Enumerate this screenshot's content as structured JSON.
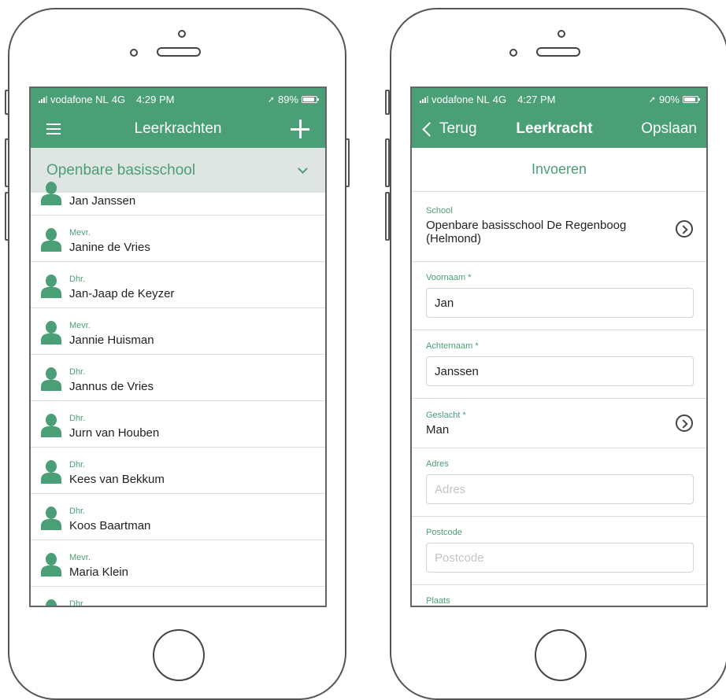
{
  "left_screen": {
    "status": {
      "carrier": "vodafone NL",
      "network": "4G",
      "time": "4:29 PM",
      "battery": "89%"
    },
    "nav": {
      "title": "Leerkrachten",
      "menu_icon": "hamburger-icon",
      "add_icon": "plus-icon"
    },
    "filter": {
      "selected": "Openbare basisschool"
    },
    "teachers": [
      {
        "prefix": "",
        "name": "Jan Janssen"
      },
      {
        "prefix": "Mevr.",
        "name": "Janine de Vries"
      },
      {
        "prefix": "Dhr.",
        "name": "Jan-Jaap de Keyzer"
      },
      {
        "prefix": "Mevr.",
        "name": "Jannie Huisman"
      },
      {
        "prefix": "Dhr.",
        "name": "Jannus de Vries"
      },
      {
        "prefix": "Dhr.",
        "name": "Jurn van Houben"
      },
      {
        "prefix": "Dhr.",
        "name": "Kees van Bekkum"
      },
      {
        "prefix": "Dhr.",
        "name": "Koos Baartman"
      },
      {
        "prefix": "Mevr.",
        "name": "Maria Klein"
      },
      {
        "prefix": "Dhr.",
        "name": ""
      }
    ]
  },
  "right_screen": {
    "status": {
      "carrier": "vodafone NL",
      "network": "4G",
      "time": "4:27 PM",
      "battery": "90%"
    },
    "nav": {
      "back": "Terug",
      "title": "Leerkracht",
      "save": "Opslaan"
    },
    "section_title": "Invoeren",
    "form": {
      "school_label": "School",
      "school_value_line1": "Openbare basisschool De Regenboog",
      "school_value_line2": "(Helmond)",
      "firstname_label": "Voornaam *",
      "firstname_value": "Jan",
      "lastname_label": "Achternaam *",
      "lastname_value": "Janssen",
      "gender_label": "Geslacht *",
      "gender_value": "Man",
      "address_label": "Adres",
      "address_placeholder": "Adres",
      "postcode_label": "Postcode",
      "postcode_placeholder": "Postcode",
      "city_label": "Plaats"
    }
  },
  "colors": {
    "primary": "#4a9f76",
    "filter_bg": "#dfe5e2"
  }
}
